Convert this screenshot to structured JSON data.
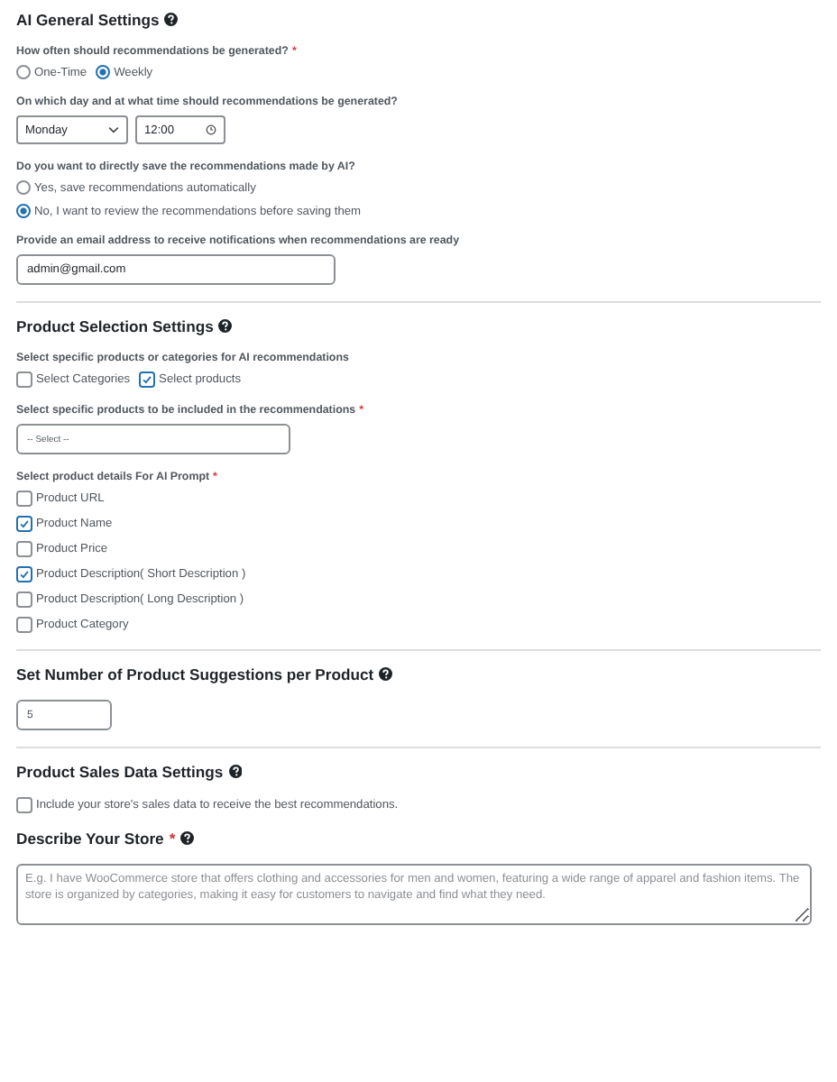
{
  "sections": [
    {
      "title": "AI General Settings",
      "help": true,
      "fields": [
        {
          "kind": "radio",
          "label": "How often should recommendations be generated?",
          "required_mark": "*",
          "inline": true,
          "options": [
            {
              "label": "One-Time",
              "selected": false
            },
            {
              "label": "Weekly",
              "selected": true
            }
          ]
        },
        {
          "kind": "day_time",
          "label": "On which day and at what time should recommendations be generated?",
          "day": "Monday",
          "time": "12:00"
        },
        {
          "kind": "radio",
          "label": "Do you want to directly save the recommendations made by AI?",
          "inline": false,
          "options": [
            {
              "label": "Yes, save recommendations automatically",
              "selected": false
            },
            {
              "label": "No, I want to review the recommendations before saving them",
              "selected": true
            }
          ]
        },
        {
          "kind": "text",
          "label": "Provide an email address to receive notifications when recommendations are ready",
          "value": "admin@gmail.com"
        }
      ]
    },
    {
      "title": "Product Selection Settings",
      "help": true,
      "fields": [
        {
          "kind": "checkbox",
          "label": "Select specific products or categories for AI recommendations",
          "inline": true,
          "options": [
            {
              "label": "Select Categories",
              "checked": false
            },
            {
              "label": "Select products",
              "checked": true
            }
          ]
        },
        {
          "kind": "multiselect",
          "label": "Select specific products to be included in the recommendations",
          "required_mark": "*",
          "placeholder": "-- Select --"
        },
        {
          "kind": "checkbox",
          "label": "Select product details For AI Prompt",
          "required_mark": "*",
          "inline": false,
          "options": [
            {
              "label": "Product URL",
              "checked": false
            },
            {
              "label": "Product Name",
              "checked": true
            },
            {
              "label": "Product Price",
              "checked": false
            },
            {
              "label": "Product Description( Short Description )",
              "checked": true
            },
            {
              "label": "Product Description( Long Description )",
              "checked": false
            },
            {
              "label": "Product Category",
              "checked": false
            }
          ]
        }
      ]
    },
    {
      "title": "Set Number of Product Suggestions per Product",
      "help": true,
      "fields": [
        {
          "kind": "number",
          "value": "5"
        }
      ]
    },
    {
      "title": "Product Sales Data Settings",
      "help": true,
      "fields": [
        {
          "kind": "checkbox",
          "inline": true,
          "options": [
            {
              "label": "Include your store's sales data to receive the best recommendations.",
              "checked": false
            }
          ]
        },
        {
          "kind": "subheading",
          "label": "Describe Your Store",
          "required_mark": "*",
          "help": true
        },
        {
          "kind": "textarea",
          "placeholder": "E.g. I have WooCommerce store that offers clothing and accessories for men and women, featuring a wide range of apparel and fashion items. The store is organized by categories, making it easy for customers to navigate and find what they need."
        }
      ]
    }
  ]
}
